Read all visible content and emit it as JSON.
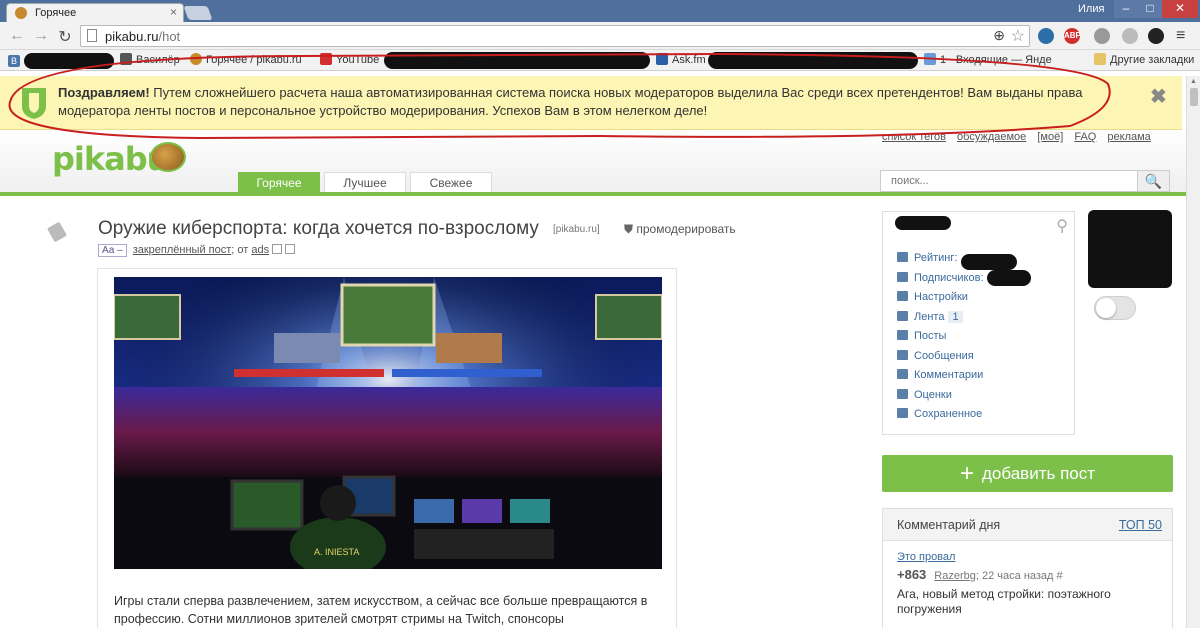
{
  "browser": {
    "tab_title": "Горячее",
    "tab_close": "×",
    "user_name": "Илия",
    "min_glyph": "–",
    "max_glyph": "□",
    "close_glyph": "✕",
    "url_host": "pikabu.ru",
    "url_path": "/hot",
    "ext_abp": "ABP",
    "bookmarks": [
      {
        "label": "В",
        "icon": "vk-icon"
      },
      {
        "label": "Василёр",
        "icon": "home-icon"
      },
      {
        "label": "Горячее / pikabu.ru",
        "icon": "pikabu-icon"
      },
      {
        "label": "YouTube",
        "icon": "youtube-icon"
      },
      {
        "label": "Ask.fm",
        "icon": "askfm-icon"
      },
      {
        "label": "1 · Входящие — Янде",
        "icon": "mail-icon"
      },
      {
        "label": "Другие закладки",
        "icon": "folder-icon"
      }
    ],
    "colors": {
      "tab_bar": "#4f6f9c",
      "close_button": "#c74141"
    }
  },
  "notification": {
    "bold": "Поздравляем!",
    "text": " Путем сложнейшего расчета наша автоматизированная система поиска новых модераторов выделила Вас среди всех претендентов! Вам выданы права модератора ленты постов и персональное устройство модерирования. Успехов Вам в этом нелегком деле!",
    "close": "✖",
    "background": "#fdf5b3"
  },
  "site": {
    "logo_text": "pikabu",
    "top_links": [
      "список тегов",
      "обсуждаемое",
      "[моё]",
      "FAQ",
      "реклама"
    ],
    "tabs": [
      "Горячее",
      "Лучшее",
      "Свежее"
    ],
    "active_tab": "Горячее",
    "search_placeholder": "поиск...",
    "search_glyph": "🔍",
    "accent": "#7cc04a"
  },
  "post": {
    "title": "Оружие киберспорта: когда хочется по-взрослому",
    "domain": "[pikabu.ru]",
    "moderate": "промодерировать",
    "aa": "Аа –",
    "pinned": "закреплённый пост",
    "from": "; от ",
    "author": "ads",
    "jersey_text": "A. INIESTA",
    "text": "Игры стали сперва развлечением, затем искусством, а сейчас все больше превращаются в профессию. Сотни миллионов зрителей смотрят стримы на Twitch, спонсоры"
  },
  "sidebar": {
    "menu": [
      {
        "label": "Рейтинг:",
        "icon": "chart-icon"
      },
      {
        "label": "Подписчиков:",
        "icon": "user-icon"
      },
      {
        "label": "Настройки",
        "icon": "gear-icon"
      },
      {
        "label": "Лента",
        "icon": "feed-icon",
        "count": "1"
      },
      {
        "label": "Посты",
        "icon": "posts-icon"
      },
      {
        "label": "Сообщения",
        "icon": "envelope-icon"
      },
      {
        "label": "Комментарии",
        "icon": "comments-icon"
      },
      {
        "label": "Оценки",
        "icon": "rating-icon"
      },
      {
        "label": "Сохраненное",
        "icon": "saved-icon"
      }
    ],
    "add_post": "добавить пост",
    "add_post_plus": "+",
    "comment_day": {
      "title": "Комментарий дня",
      "top": "ТОП 50",
      "post_link": "Это провал",
      "score": "+863",
      "author": "Razerbg",
      "time": "22 часа назад",
      "hash": "#",
      "text": "Ага, новый метод стройки: поэтажного погружения"
    }
  }
}
